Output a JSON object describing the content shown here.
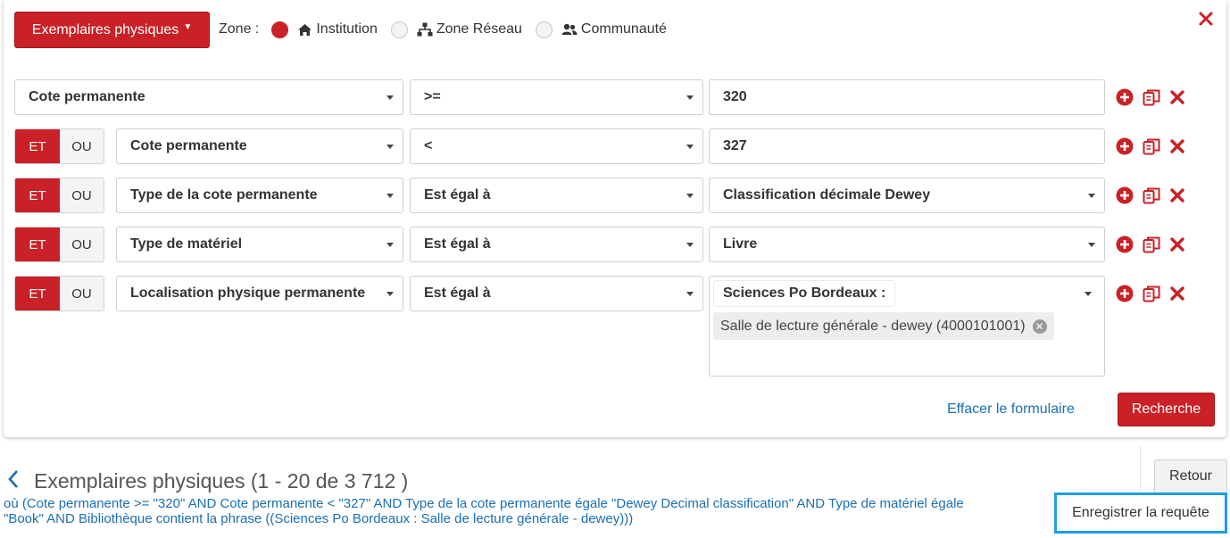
{
  "type_selector": {
    "label": "Exemplaires physiques"
  },
  "zone": {
    "label": "Zone :",
    "options": [
      {
        "label": "Institution",
        "selected": true,
        "icon": "home-icon"
      },
      {
        "label": "Zone Réseau",
        "selected": false,
        "icon": "network-icon"
      },
      {
        "label": "Communauté",
        "selected": false,
        "icon": "users-icon"
      }
    ]
  },
  "logic": {
    "and": "ET",
    "or": "OU"
  },
  "criteria": [
    {
      "field": "Cote permanente",
      "operator": ">=",
      "value": "320"
    },
    {
      "field": "Cote permanente",
      "operator": "<",
      "value": "327"
    },
    {
      "field": "Type de la cote permanente",
      "operator": "Est égal à",
      "value": "Classification décimale Dewey"
    },
    {
      "field": "Type de matériel",
      "operator": "Est égal à",
      "value": "Livre"
    },
    {
      "field": "Localisation physique permanente",
      "operator": "Est égal à",
      "value_group": "Sciences Po Bordeaux :",
      "value_tag": "Salle de lecture générale - dewey (4000101001)"
    }
  ],
  "form_actions": {
    "clear": "Effacer le formulaire",
    "search": "Recherche"
  },
  "results": {
    "title": "Exemplaires physiques (1 - 20 de 3 712 )",
    "query": "où (Cote permanente >= \"320\" AND Cote permanente < \"327\" AND Type de la cote permanente égale \"Dewey Decimal classification\" AND Type de matériel égale \"Book\" AND Bibliothèque contient la phrase ((Sciences Po Bordeaux : Salle de lecture générale - dewey)))",
    "back_button": "Retour",
    "save_query": "Enregistrer la requête"
  },
  "colors": {
    "primary": "#c92127",
    "link": "#1a6fb4",
    "highlight": "#1e9ee3"
  }
}
